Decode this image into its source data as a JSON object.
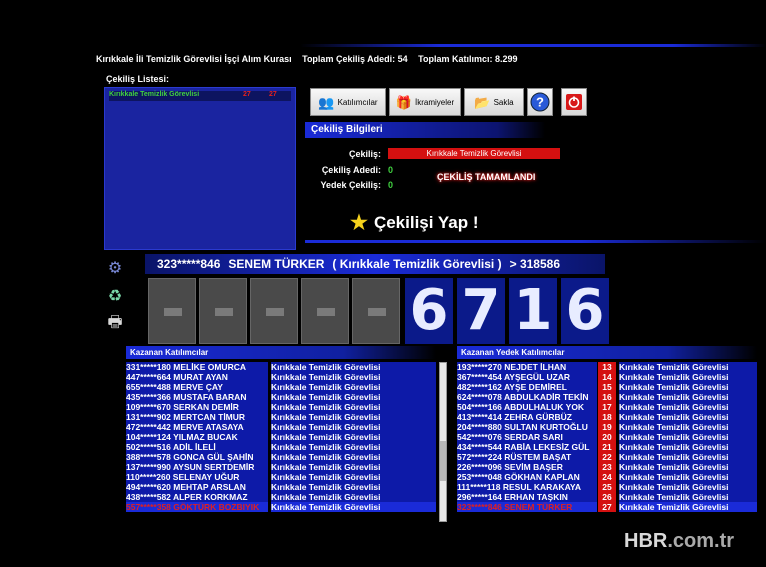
{
  "header": {
    "title": "Kırıkkale İli Temizlik Görevlisi İşçi Alım Kurası",
    "total_draws": "Toplam Çekiliş Adedi: 54",
    "total_participants": "Toplam Katılımcı: 8.299"
  },
  "draw_list": {
    "label": "Çekiliş Listesi:",
    "items": [
      {
        "name": "Kırıkkale Temizlik Görevlisi",
        "n1": "27",
        "n2": "27"
      }
    ]
  },
  "toolbar": {
    "participants_label": "Katılımcılar",
    "prizes_label": "İkramiyeler",
    "save_label": "Sakla"
  },
  "draw_info": {
    "section_title": "Çekiliş Bilgileri",
    "draw_label": "Çekiliş:",
    "draw_value": "Kırıkkale Temizlik Görevlisi",
    "count_label": "Çekiliş Adedi:",
    "count_value": "0",
    "backup_label": "Yedek Çekiliş:",
    "backup_value": "0",
    "status": "ÇEKİLİŞ TAMAMLANDI",
    "draw_button": "Çekilişi Yap !"
  },
  "current_winner": {
    "id": "323*****846",
    "name": "SENEM TÜRKER",
    "draw": "( Kırıkkale Temizlik Görevlisi )",
    "ref": "> 318586"
  },
  "digits": [
    "6",
    "7",
    "1",
    "6"
  ],
  "winners": {
    "title": "Kazanan Katılımcılar",
    "rows": [
      {
        "name": "331*****180 MELİKE OMURCA",
        "draw": "Kırıkkale Temizlik Görevlisi"
      },
      {
        "name": "447*****664 MURAT AYAN",
        "draw": "Kırıkkale Temizlik Görevlisi"
      },
      {
        "name": "655*****488 MERVE ÇAY",
        "draw": "Kırıkkale Temizlik Görevlisi"
      },
      {
        "name": "435*****366 MUSTAFA BARAN",
        "draw": "Kırıkkale Temizlik Görevlisi"
      },
      {
        "name": "109*****670 SERKAN DEMİR",
        "draw": "Kırıkkale Temizlik Görevlisi"
      },
      {
        "name": "131*****902 MERTCAN TİMUR",
        "draw": "Kırıkkale Temizlik Görevlisi"
      },
      {
        "name": "472*****442 MERVE ATASAYA",
        "draw": "Kırıkkale Temizlik Görevlisi"
      },
      {
        "name": "104*****124 YILMAZ BUCAK",
        "draw": "Kırıkkale Temizlik Görevlisi"
      },
      {
        "name": "502*****516 ADİL İLELİ",
        "draw": "Kırıkkale Temizlik Görevlisi"
      },
      {
        "name": "388*****578 GONCA GÜL ŞAHİN",
        "draw": "Kırıkkale Temizlik Görevlisi"
      },
      {
        "name": "137*****990 AYSUN SERTDEMİR",
        "draw": "Kırıkkale Temizlik Görevlisi"
      },
      {
        "name": "110*****260 SELENAY UĞUR",
        "draw": "Kırıkkale Temizlik Görevlisi"
      },
      {
        "name": "494*****620 MEHTAP ARSLAN",
        "draw": "Kırıkkale Temizlik Görevlisi"
      },
      {
        "name": "438*****582 ALPER KORKMAZ",
        "draw": "Kırıkkale Temizlik Görevlisi"
      },
      {
        "name": "557*****358 GÖKTÜRK BOZBIYIK",
        "draw": "Kırıkkale Temizlik Görevlisi"
      }
    ]
  },
  "backups": {
    "title": "Kazanan Yedek Katılımcılar",
    "rows": [
      {
        "name": "193*****270 NEJDET İLHAN",
        "no": "13",
        "draw": "Kırıkkale Temizlik Görevlisi"
      },
      {
        "name": "367*****454 AYŞEGÜL UZAR",
        "no": "14",
        "draw": "Kırıkkale Temizlik Görevlisi"
      },
      {
        "name": "482*****162 AYŞE DEMİREL",
        "no": "15",
        "draw": "Kırıkkale Temizlik Görevlisi"
      },
      {
        "name": "624*****078 ABDULKADİR TEKİN",
        "no": "16",
        "draw": "Kırıkkale Temizlik Görevlisi"
      },
      {
        "name": "504*****166 ABDULHALUK YOK",
        "no": "17",
        "draw": "Kırıkkale Temizlik Görevlisi"
      },
      {
        "name": "413*****414 ZEHRA GÜRBÜZ",
        "no": "18",
        "draw": "Kırıkkale Temizlik Görevlisi"
      },
      {
        "name": "204*****880 SULTAN KURTOĞLU",
        "no": "19",
        "draw": "Kırıkkale Temizlik Görevlisi"
      },
      {
        "name": "542*****076 SERDAR SARI",
        "no": "20",
        "draw": "Kırıkkale Temizlik Görevlisi"
      },
      {
        "name": "434*****544 RABİA LEKESİZ GÜL",
        "no": "21",
        "draw": "Kırıkkale Temizlik Görevlisi"
      },
      {
        "name": "572*****224 RÜSTEM BAŞAT",
        "no": "22",
        "draw": "Kırıkkale Temizlik Görevlisi"
      },
      {
        "name": "226*****096 SEVİM BAŞER",
        "no": "23",
        "draw": "Kırıkkale Temizlik Görevlisi"
      },
      {
        "name": "253*****048 GÖKHAN KAPLAN",
        "no": "24",
        "draw": "Kırıkkale Temizlik Görevlisi"
      },
      {
        "name": "111*****118 RESUL KARAKAYA",
        "no": "25",
        "draw": "Kırıkkale Temizlik Görevlisi"
      },
      {
        "name": "296*****164 ERHAN TAŞKIN",
        "no": "26",
        "draw": "Kırıkkale Temizlik Görevlisi"
      },
      {
        "name": "323*****846 SENEM TÜRKER",
        "no": "27",
        "draw": "Kırıkkale Temizlik Görevlisi"
      }
    ]
  },
  "watermark": {
    "brand": "HBR",
    "domain": ".com.tr"
  }
}
